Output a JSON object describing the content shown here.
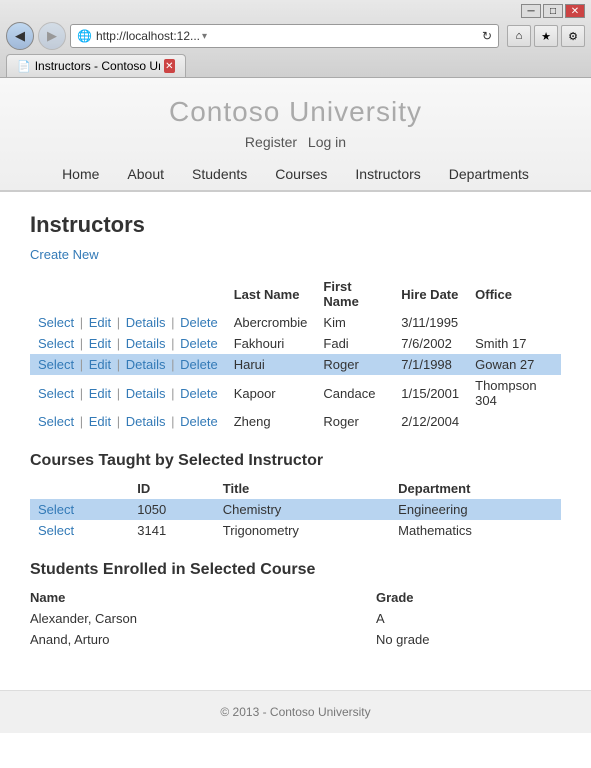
{
  "browser": {
    "address": "http://localhost:12...",
    "tab_title": "Instructors - Contoso Unive...",
    "back_icon": "◀",
    "forward_icon": "▶",
    "home_icon": "⌂",
    "star_icon": "★",
    "gear_icon": "⚙",
    "refresh_icon": "↻",
    "search_icon": "🔍",
    "tab_close_icon": "✕",
    "win_min": "─",
    "win_max": "□",
    "win_close": "✕"
  },
  "site": {
    "title": "Contoso University",
    "auth": {
      "register": "Register",
      "login": "Log in"
    },
    "nav": [
      "Home",
      "About",
      "Students",
      "Courses",
      "Instructors",
      "Departments"
    ]
  },
  "page": {
    "heading": "Instructors",
    "create_new": "Create New"
  },
  "instructors_table": {
    "columns": [
      "",
      "Last Name",
      "First Name",
      "Hire Date",
      "Office"
    ],
    "rows": [
      {
        "actions": [
          "Select",
          "Edit",
          "Details",
          "Delete"
        ],
        "last_name": "Abercrombie",
        "first_name": "Kim",
        "hire_date": "3/11/1995",
        "office": "",
        "selected": false
      },
      {
        "actions": [
          "Select",
          "Edit",
          "Details",
          "Delete"
        ],
        "last_name": "Fakhouri",
        "first_name": "Fadi",
        "hire_date": "7/6/2002",
        "office": "Smith 17",
        "selected": false
      },
      {
        "actions": [
          "Select",
          "Edit",
          "Details",
          "Delete"
        ],
        "last_name": "Harui",
        "first_name": "Roger",
        "hire_date": "7/1/1998",
        "office": "Gowan 27",
        "selected": true
      },
      {
        "actions": [
          "Select",
          "Edit",
          "Details",
          "Delete"
        ],
        "last_name": "Kapoor",
        "first_name": "Candace",
        "hire_date": "1/15/2001",
        "office": "Thompson 304",
        "selected": false
      },
      {
        "actions": [
          "Select",
          "Edit",
          "Details",
          "Delete"
        ],
        "last_name": "Zheng",
        "first_name": "Roger",
        "hire_date": "2/12/2004",
        "office": "",
        "selected": false
      }
    ]
  },
  "courses_section": {
    "heading": "Courses Taught by Selected Instructor",
    "columns": [
      "ID",
      "Title",
      "Department"
    ],
    "rows": [
      {
        "id": "1050",
        "title": "Chemistry",
        "department": "Engineering",
        "selected": true
      },
      {
        "id": "3141",
        "title": "Trigonometry",
        "department": "Mathematics",
        "selected": false
      }
    ]
  },
  "students_section": {
    "heading": "Students Enrolled in Selected Course",
    "columns": [
      "Name",
      "Grade"
    ],
    "rows": [
      {
        "name": "Alexander, Carson",
        "grade": "A"
      },
      {
        "name": "Anand, Arturo",
        "grade": "No grade"
      }
    ]
  },
  "footer": {
    "text": "© 2013 - Contoso University"
  }
}
